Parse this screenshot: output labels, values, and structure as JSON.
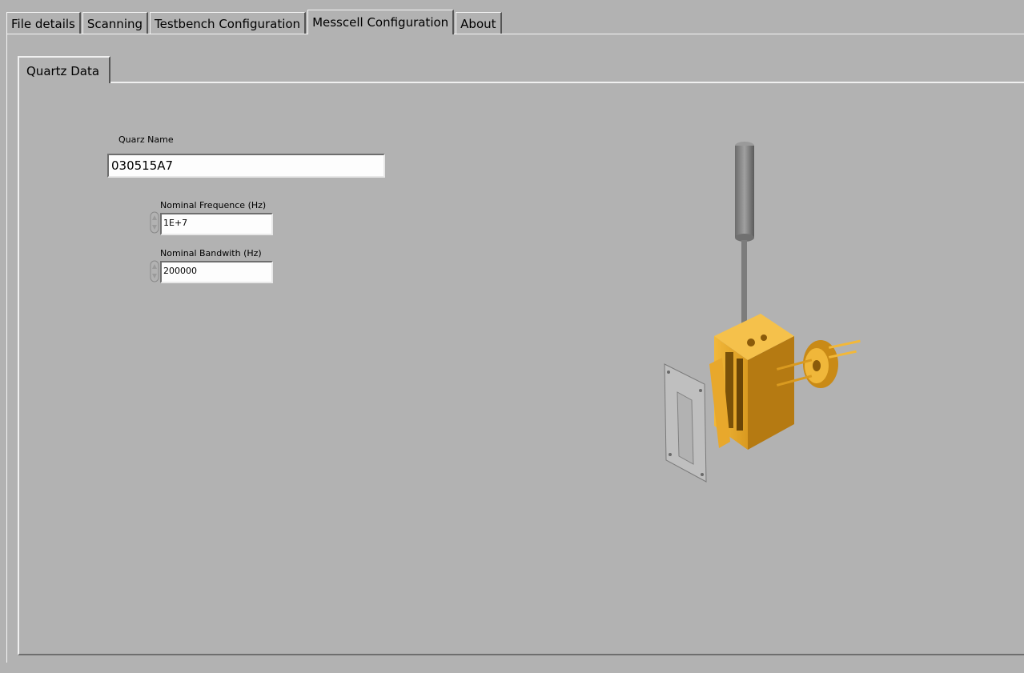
{
  "top_tabs": [
    {
      "label": "File details",
      "active": false
    },
    {
      "label": "Scanning",
      "active": false
    },
    {
      "label": "Testbench Configuration",
      "active": false
    },
    {
      "label": "Messcell Configuration",
      "active": true
    },
    {
      "label": "About",
      "active": false
    }
  ],
  "inner_tab": {
    "label": "Quartz Data"
  },
  "quartz": {
    "name_label": "Quarz Name",
    "name_value": "030515A7",
    "freq_label": "Nominal Frequence (Hz)",
    "freq_value": "1E+7",
    "bw_label": "Nominal Bandwith (Hz)",
    "bw_value": "200000"
  },
  "icons": {
    "spinner": "up-down-spinner-icon",
    "illustration": "messcell-cad-illustration"
  },
  "colors": {
    "background": "#b2b2b2",
    "field": "#fdfdfd",
    "cell_gold": "#e3a52a"
  }
}
